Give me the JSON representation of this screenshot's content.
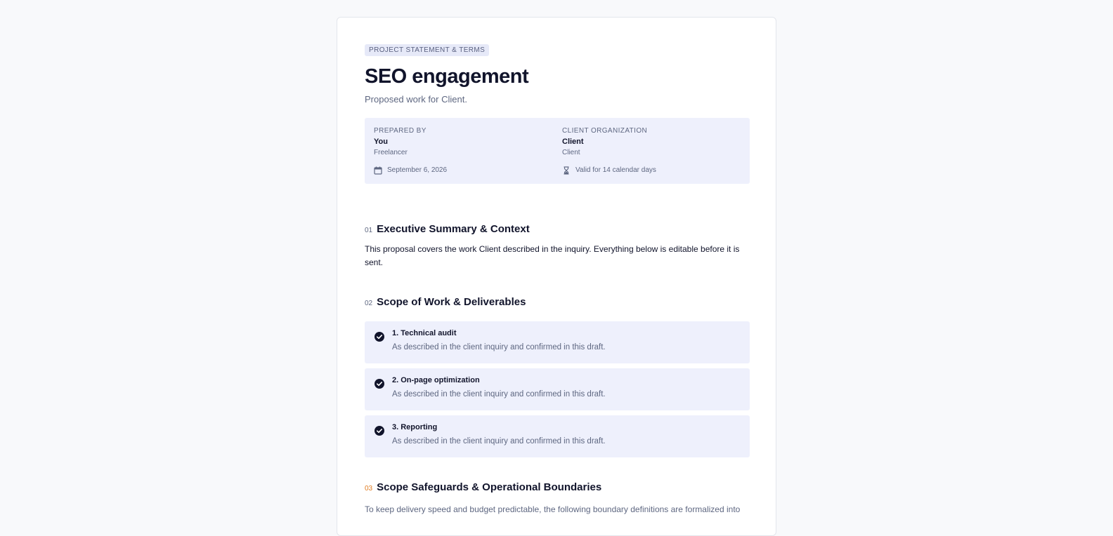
{
  "document": {
    "tag": "PROJECT STATEMENT & TERMS",
    "title": "SEO engagement",
    "subtitle": "Proposed work for Client."
  },
  "meta": {
    "prepared_by": {
      "label": "PREPARED BY",
      "name": "You",
      "role": "Freelancer"
    },
    "client": {
      "label": "CLIENT ORGANIZATION",
      "name": "Client",
      "role": "Client"
    },
    "date": {
      "icon": "calendar-icon",
      "text": "September 6, 2026"
    },
    "validity": {
      "icon": "hourglass-icon",
      "text": "Valid for 14 calendar days"
    }
  },
  "sections": [
    {
      "number": "01",
      "title": "Executive Summary & Context",
      "body": "This proposal covers the work Client described in the inquiry. Everything below is editable before it is sent."
    },
    {
      "number": "02",
      "title": "Scope of Work & Deliverables",
      "deliverables": [
        {
          "title": "1. Technical audit",
          "description": "As described in the client inquiry and confirmed in this draft."
        },
        {
          "title": "2. On-page optimization",
          "description": "As described in the client inquiry and confirmed in this draft."
        },
        {
          "title": "3. Reporting",
          "description": "As described in the client inquiry and confirmed in this draft."
        }
      ]
    },
    {
      "number": "03",
      "title": "Scope Safeguards & Operational Boundaries",
      "body": "To keep delivery speed and budget predictable, the following boundary definitions are formalized into"
    }
  ],
  "colors": {
    "accent_number": "#e07b1f",
    "panel": "#eef0fc",
    "text": "#11142b",
    "muted": "#5e6781"
  }
}
